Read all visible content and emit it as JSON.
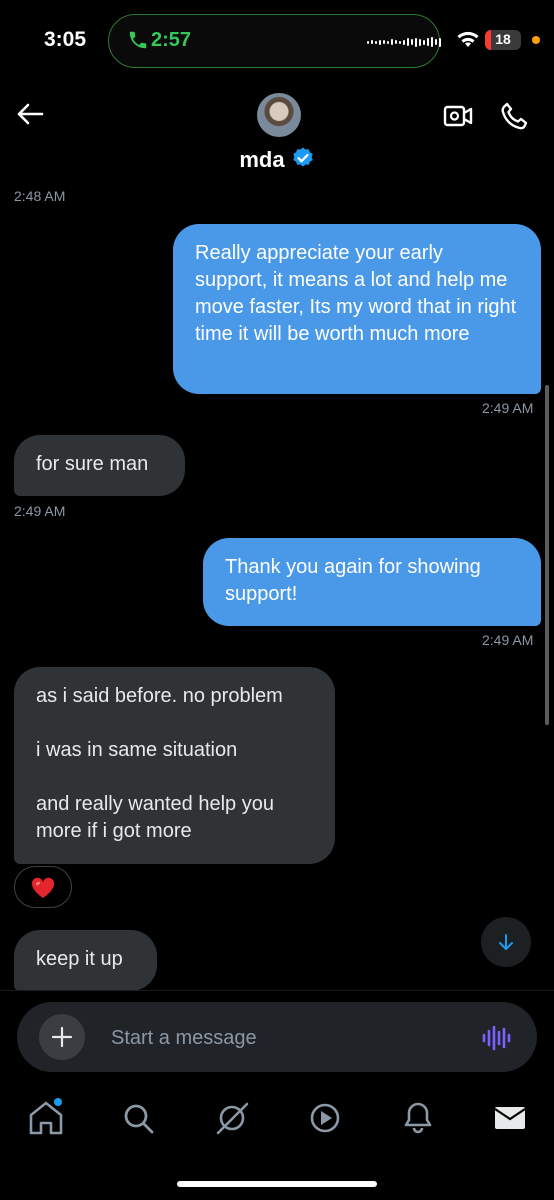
{
  "status_bar": {
    "time": "3:05",
    "call_duration": "2:57",
    "battery_level": "18",
    "battery_fraction": 0.18
  },
  "header": {
    "contact_name": "mda",
    "verified": true
  },
  "messages": [
    {
      "type": "timestamp",
      "text": "2:48 AM"
    },
    {
      "type": "sent",
      "text": "Really appreciate your early support, it means a lot and help me move faster, Its my word that in right time it will be worth much more"
    },
    {
      "type": "timestamp",
      "text": "2:49 AM"
    },
    {
      "type": "received",
      "text": "for sure man"
    },
    {
      "type": "timestamp",
      "text": "2:49 AM"
    },
    {
      "type": "sent",
      "text": "Thank you again for showing support!"
    },
    {
      "type": "timestamp",
      "text": "2:49 AM"
    },
    {
      "type": "received",
      "paragraphs": [
        "as i said before. no problem",
        "i was in same situation",
        "and really wanted help you more if i got more"
      ]
    },
    {
      "type": "reaction",
      "emoji": "❤️"
    },
    {
      "type": "received",
      "text": "keep it up"
    }
  ],
  "composer": {
    "placeholder": "Start a message"
  },
  "tabs": [
    {
      "icon": "home-icon",
      "has_badge": true
    },
    {
      "icon": "search-icon"
    },
    {
      "icon": "grok-icon"
    },
    {
      "icon": "video-play-icon"
    },
    {
      "icon": "notifications-bell-icon"
    },
    {
      "icon": "messages-envelope-icon"
    }
  ],
  "colors": {
    "sent_bubble": "#4a99e9",
    "received_bubble": "#2f3336",
    "accent_blue": "#1d9bf0",
    "call_green": "#34c759"
  }
}
